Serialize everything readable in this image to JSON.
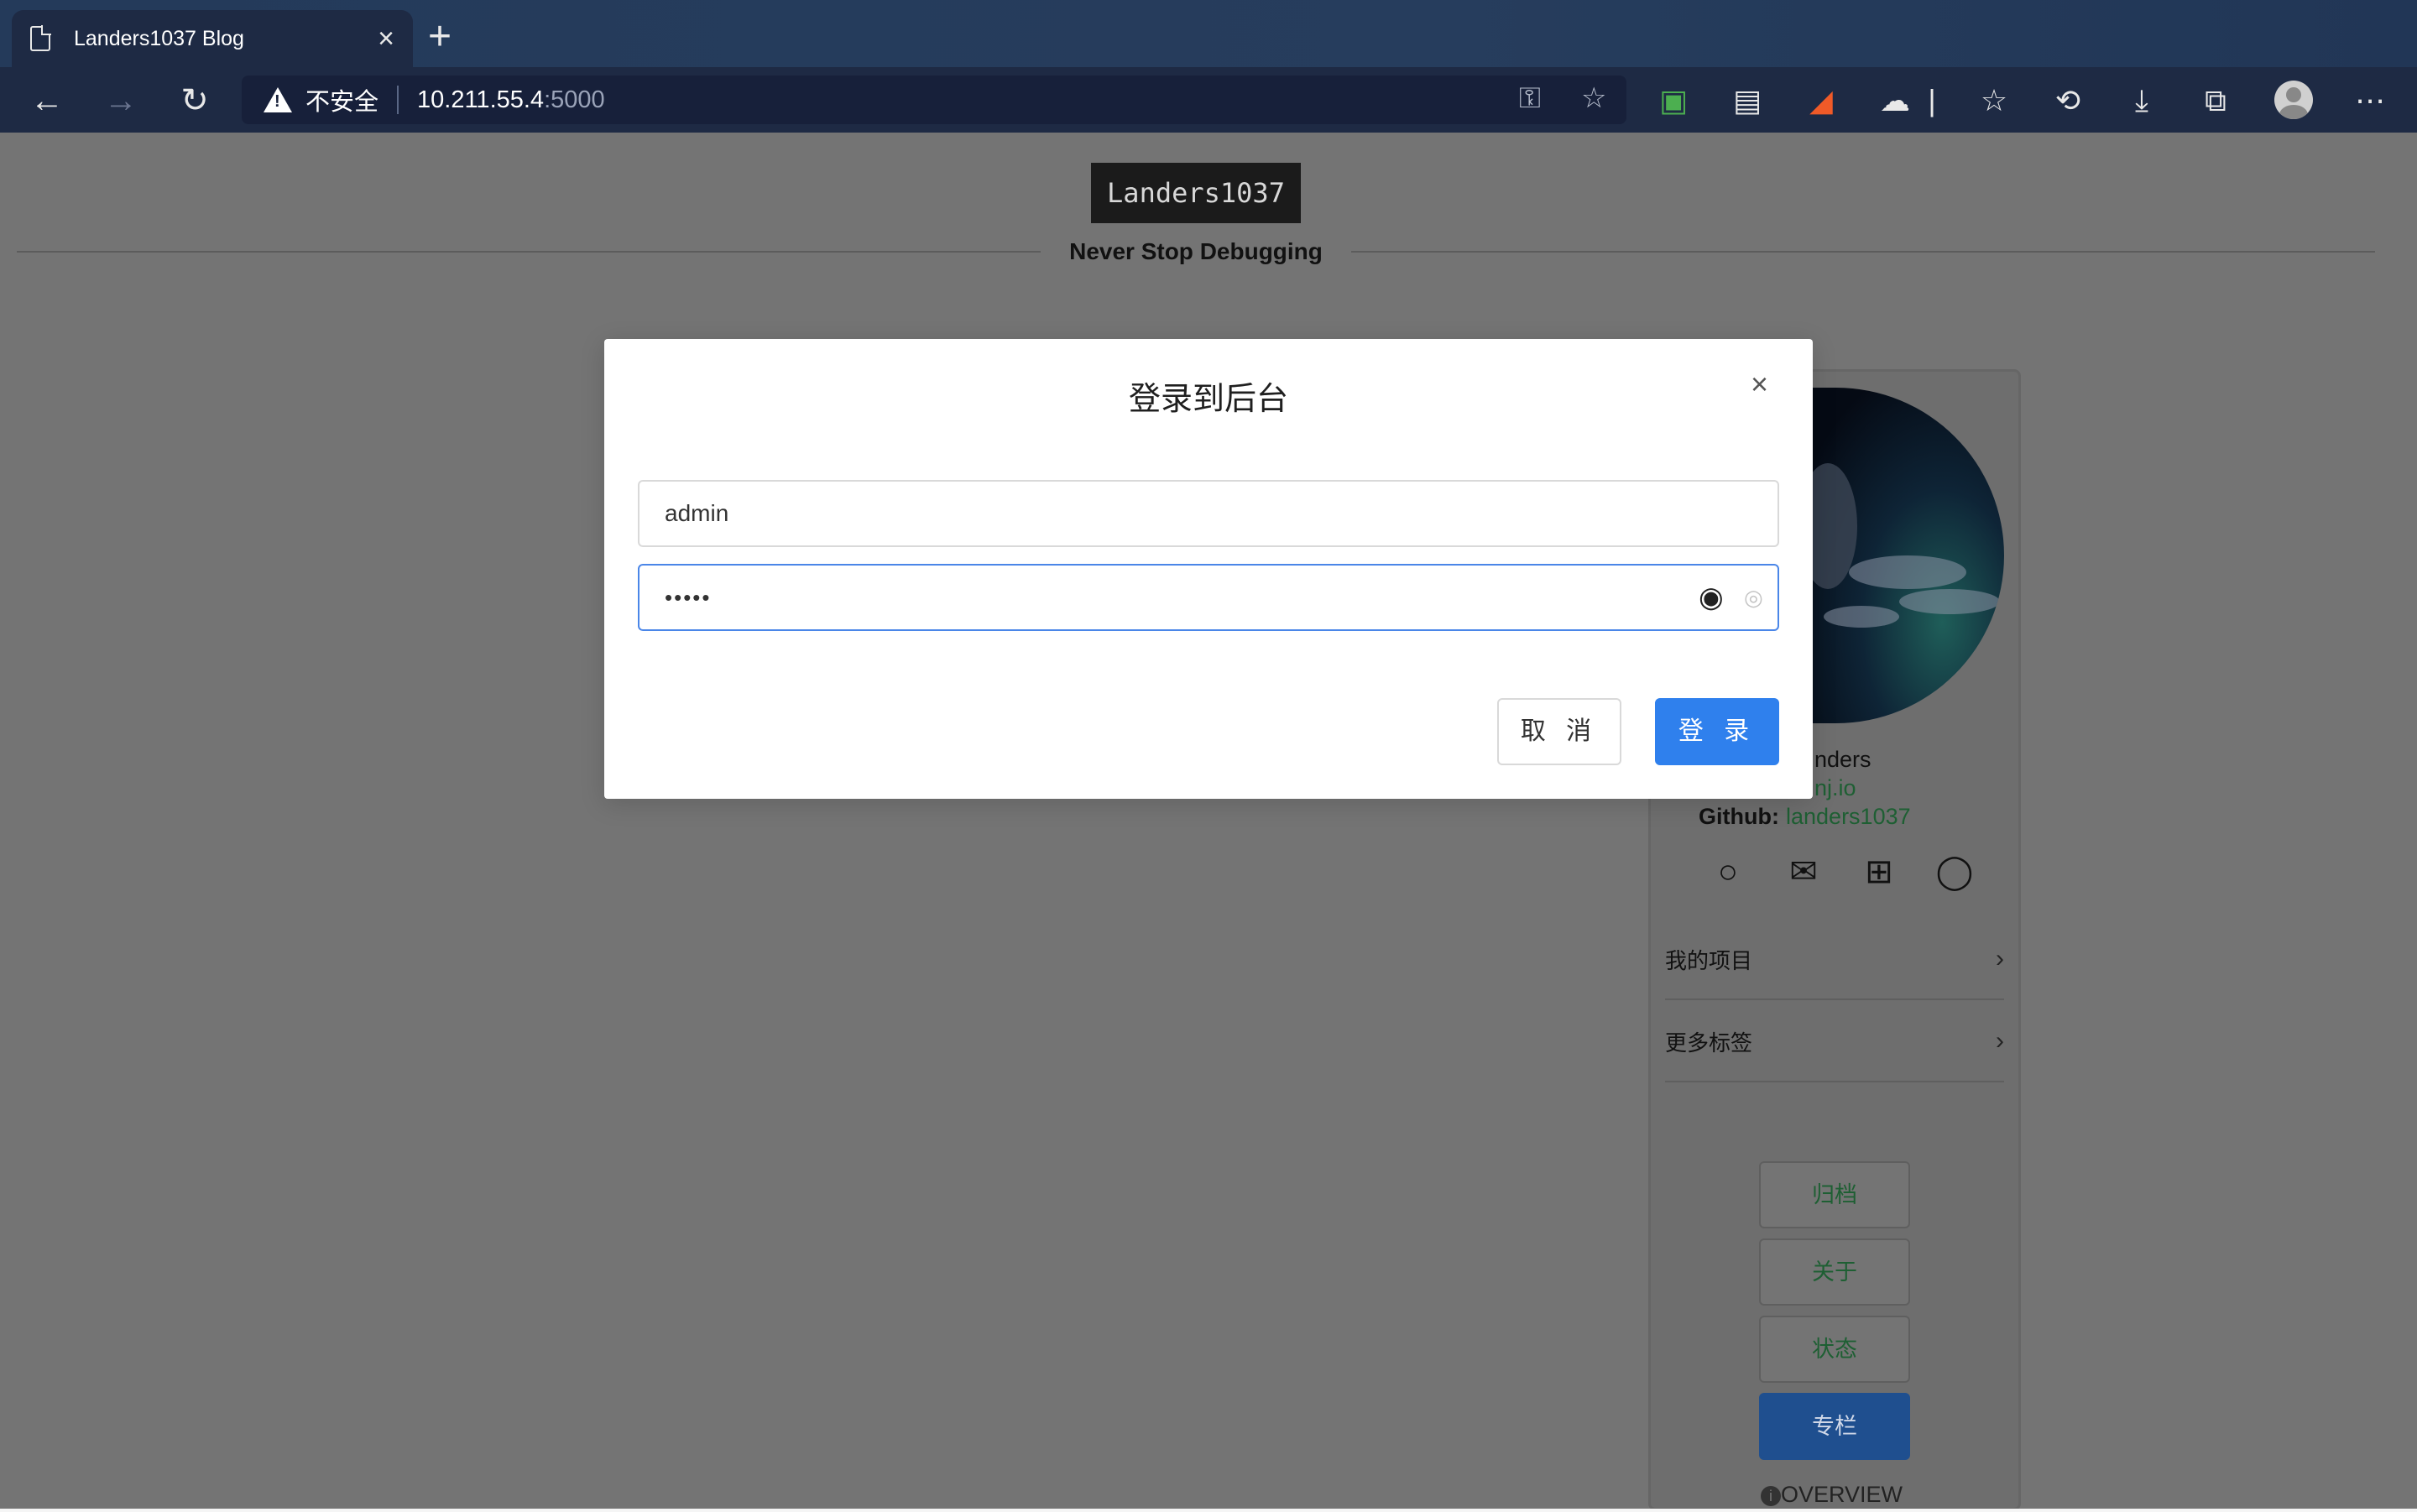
{
  "browser": {
    "tab_title": "Landers1037 Blog",
    "tab_close": "×",
    "new_tab": "+",
    "address": {
      "security_label": "不安全",
      "host": "10.211.55.4",
      "port": ":5000"
    }
  },
  "site": {
    "logo": "Landers1037",
    "tagline": "Never Stop Debugging"
  },
  "sidebar": {
    "name_partial": "nders",
    "site_partial": "nj.io",
    "github_label": "Github:",
    "github_value": "landers1037",
    "menu": [
      {
        "label": "我的项目",
        "chevron": "›"
      },
      {
        "label": "更多标签",
        "chevron": "›"
      }
    ],
    "buttons": [
      "归档",
      "关于",
      "状态",
      "专栏"
    ],
    "overview": "OVERVIEW"
  },
  "modal": {
    "title": "登录到后台",
    "close": "×",
    "username_value": "admin",
    "password_value": "•••••",
    "cancel_label": "取 消",
    "login_label": "登 录"
  },
  "colors": {
    "primary": "#2f80ed",
    "browser_chrome": "#1e2a44",
    "overlay_page": "#747474",
    "link_green": "#1e5f33"
  }
}
